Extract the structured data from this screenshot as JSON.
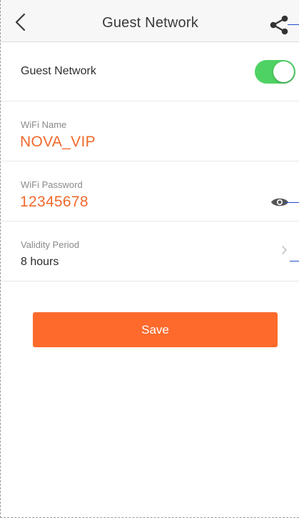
{
  "header": {
    "title": "Guest Network",
    "back_icon": "chevron-left-icon",
    "share_icon": "share-icon"
  },
  "guest_network": {
    "label": "Guest Network",
    "enabled": true
  },
  "wifi_name": {
    "label": "WiFi Name",
    "value": "NOVA_VIP"
  },
  "wifi_password": {
    "label": "WiFi Password",
    "value": "12345678",
    "visibility_icon": "eye-icon"
  },
  "validity": {
    "label": "Validity Period",
    "value": "8 hours",
    "chevron_icon": "chevron-right-icon"
  },
  "actions": {
    "save_label": "Save"
  },
  "colors": {
    "accent": "#fd6a2c",
    "value_text": "#f06a2b",
    "toggle_on": "#4fd264",
    "callout": "#1f4fcc"
  }
}
